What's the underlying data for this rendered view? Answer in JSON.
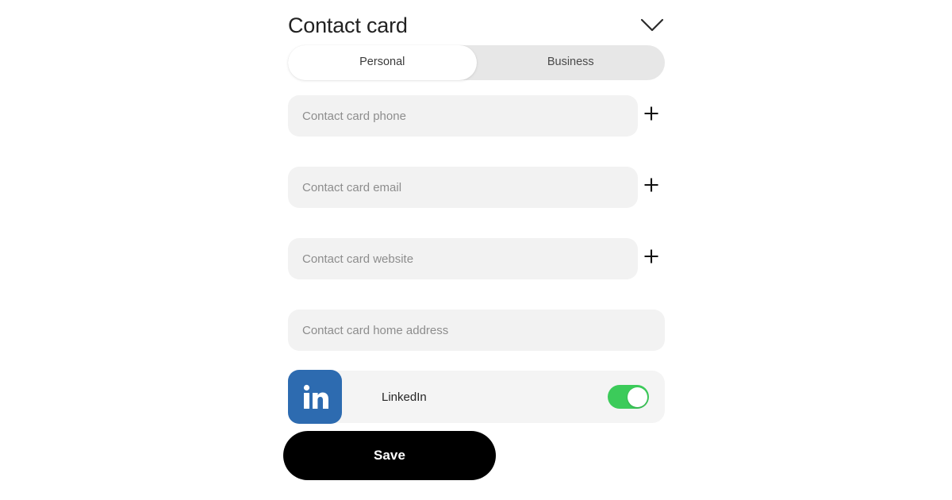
{
  "header": {
    "title": "Contact card",
    "collapse_icon": "chevron-down-icon"
  },
  "segmented": {
    "tabs": [
      {
        "label": "Personal",
        "selected": true
      },
      {
        "label": "Business",
        "selected": false
      }
    ]
  },
  "fields": [
    {
      "placeholder": "Contact card phone",
      "value": "",
      "has_add": true,
      "add_icon": "plus-icon"
    },
    {
      "placeholder": "Contact card email",
      "value": "",
      "has_add": true,
      "add_icon": "plus-icon"
    },
    {
      "placeholder": "Contact card website",
      "value": "",
      "has_add": true,
      "add_icon": "plus-icon"
    },
    {
      "placeholder": "Contact card home address",
      "value": "",
      "has_add": false,
      "add_icon": ""
    }
  ],
  "social": {
    "icon": "linkedin-icon",
    "label": "LinkedIn",
    "toggle_on": true
  },
  "save": {
    "label": "Save"
  },
  "colors": {
    "field_background": "#f2f2f2",
    "segmented_track": "#e7e7e7",
    "placeholder_text": "#8d8d8d",
    "linkedin_blue": "#2d6bb0",
    "toggle_on_green": "#3ccb5a",
    "save_background": "#000000",
    "save_text": "#ffffff"
  }
}
